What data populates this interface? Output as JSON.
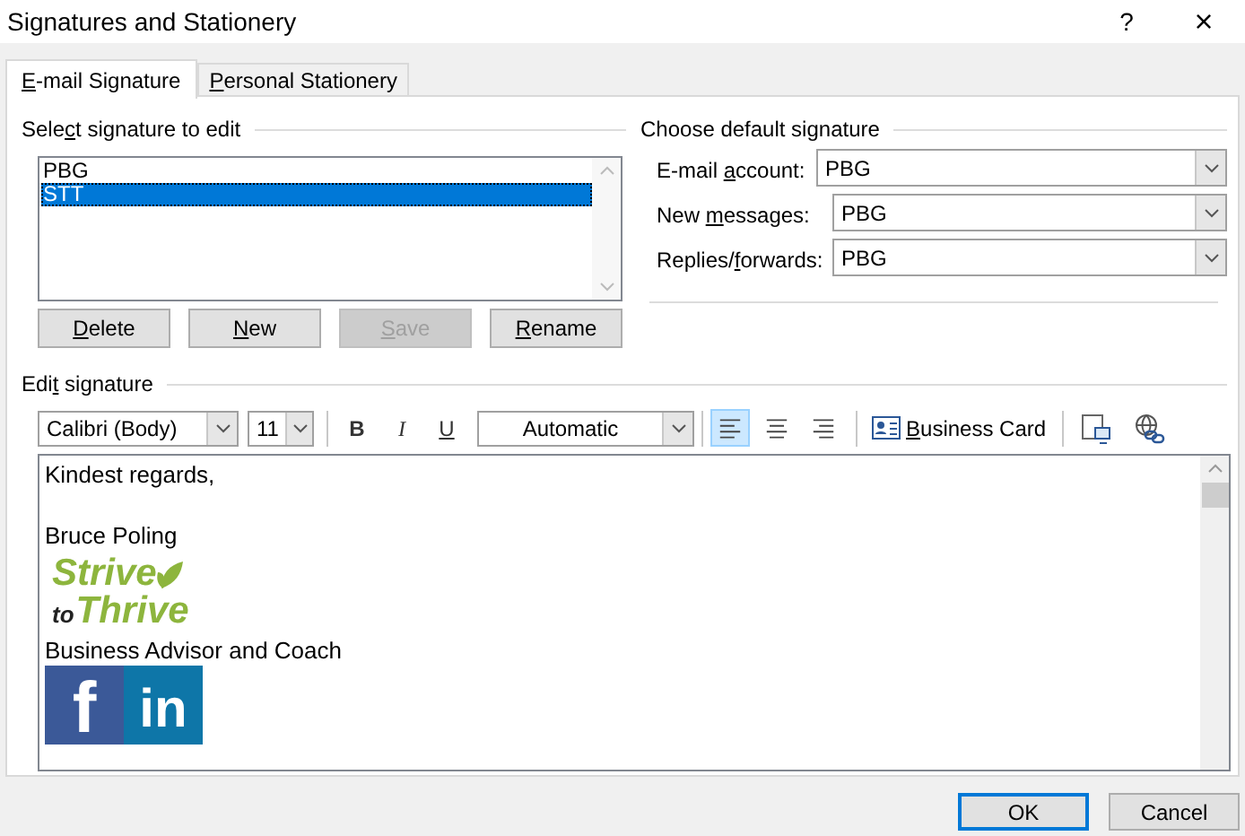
{
  "window": {
    "title": "Signatures and Stationery",
    "help": "?",
    "close": "×"
  },
  "tabs": [
    {
      "key": "E",
      "post": "-mail Signature",
      "selected": true
    },
    {
      "key": "P",
      "post": "ersonal Stationery",
      "selected": false
    }
  ],
  "select_signature": {
    "heading": {
      "pre": "Sele",
      "key": "c",
      "post": "t signature to edit"
    },
    "items": [
      {
        "label": "PBG",
        "selected": false
      },
      {
        "label": "STT",
        "selected": true
      }
    ],
    "buttons": [
      {
        "key": "D",
        "post": "elete",
        "disabled": false
      },
      {
        "key": "N",
        "post": "ew",
        "disabled": false
      },
      {
        "key": "S",
        "post": "ave",
        "disabled": true
      },
      {
        "key": "R",
        "post": "ename",
        "disabled": false
      }
    ]
  },
  "default_signature": {
    "heading": "Choose default signature",
    "fields": [
      {
        "label": {
          "pre": "E-mail ",
          "key": "a",
          "post": "ccount:"
        },
        "value": "PBG"
      },
      {
        "label": {
          "pre": "New ",
          "key": "m",
          "post": "essages:"
        },
        "value": "PBG"
      },
      {
        "label": {
          "pre": "Replies/",
          "key": "f",
          "post": "orwards:"
        },
        "value": "PBG"
      }
    ]
  },
  "edit_signature": {
    "heading": {
      "pre": "Edi",
      "key": "t",
      "post": " signature"
    },
    "font": "Calibri (Body)",
    "size": "11",
    "bold": "B",
    "italic": "I",
    "underline": "U",
    "font_color_choice": "Automatic",
    "align": [
      {
        "selected": true
      },
      {
        "selected": false
      },
      {
        "selected": false
      }
    ],
    "business_card": {
      "key": "B",
      "post": "usiness Card"
    },
    "body": [
      {
        "kind": "text",
        "text": "Kindest regards,"
      },
      {
        "kind": "blank"
      },
      {
        "kind": "text",
        "text": "Bruce Poling"
      },
      {
        "kind": "logo",
        "line1": "Strive",
        "small": "to",
        "line2": "Thrive"
      },
      {
        "kind": "text",
        "text": "Business Advisor and Coach"
      },
      {
        "kind": "social",
        "icons": [
          {
            "text": "f",
            "color": "#3b5998"
          },
          {
            "text": "in",
            "color": "#0e76a8"
          }
        ]
      }
    ]
  },
  "buttons": [
    {
      "label": "OK",
      "default": true
    },
    {
      "label": "Cancel",
      "default": false
    }
  ]
}
